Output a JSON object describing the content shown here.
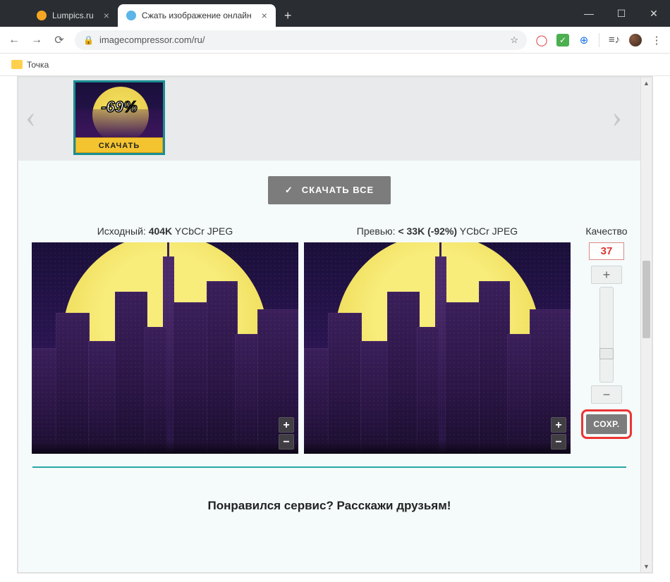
{
  "browser": {
    "tabs": [
      {
        "title": "Lumpics.ru",
        "active": false
      },
      {
        "title": "Сжать изображение онлайн",
        "active": true
      }
    ],
    "url_display": "imagecompressor.com/ru/",
    "bookmarks": [
      {
        "label": "Точка"
      }
    ]
  },
  "queue": {
    "items": [
      {
        "reduction": "-69%",
        "download_label": "СКАЧАТЬ"
      }
    ],
    "download_all_label": "СКАЧАТЬ ВСЕ"
  },
  "compare": {
    "original": {
      "prefix": "Исходный: ",
      "size": "404K",
      "meta": " YCbCr JPEG"
    },
    "preview": {
      "prefix": "Превью: ",
      "size": "< 33K (-92%)",
      "meta": " YCbCr JPEG"
    }
  },
  "quality_panel": {
    "label": "Качество",
    "value": "37",
    "plus": "+",
    "minus": "−",
    "save_label": "СОХР."
  },
  "footer_text": "Понравился сервис? Расскажи друзьям!"
}
